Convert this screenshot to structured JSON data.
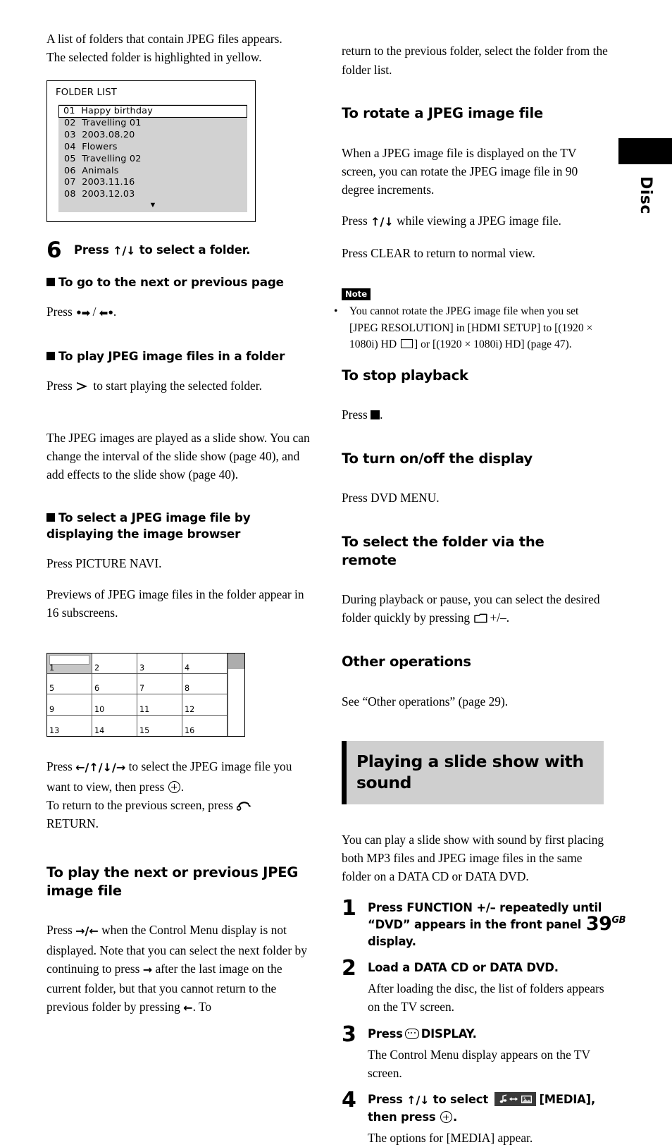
{
  "page": {
    "number": "39",
    "number_suffix": "GB",
    "side_tab_label": "Disc"
  },
  "left_column": {
    "intro": [
      "A list of folders that contain JPEG files appears.",
      "The selected folder is highlighted in yellow."
    ],
    "folder_list": {
      "title": "FOLDER LIST",
      "rows": [
        {
          "num": "01",
          "name": "Happy birthday",
          "selected": true
        },
        {
          "num": "02",
          "name": "Travelling 01",
          "selected": false
        },
        {
          "num": "03",
          "name": "2003.08.20",
          "selected": false
        },
        {
          "num": "04",
          "name": "Flowers",
          "selected": false
        },
        {
          "num": "05",
          "name": "Travelling 02",
          "selected": false
        },
        {
          "num": "06",
          "name": "Animals",
          "selected": false
        },
        {
          "num": "07",
          "name": "2003.11.16",
          "selected": false
        },
        {
          "num": "08",
          "name": "2003.12.03",
          "selected": false
        }
      ],
      "more_indicator": "▼"
    },
    "step6": {
      "number": "6",
      "lead_before": "Press ",
      "lead_arrows": "↑/↓",
      "lead_after": " to select a folder."
    },
    "sub_next_prev_page": {
      "heading": "To go to the next or previous page",
      "press_label": "Press",
      "trailing": "."
    },
    "sub_play_jpeg": {
      "heading": "To play JPEG image files in a folder",
      "press_label": "Press",
      "after_icon": " to start playing the selected folder.",
      "paragraph": "The JPEG images are played as a slide show. You can change the interval of the slide show (page 40), and add effects to the slide show (page 40)."
    },
    "sub_image_browser": {
      "heading_line1": "To select a JPEG image file by",
      "heading_line2": "displaying the image browser",
      "line1": "Press PICTURE NAVI.",
      "line2": "Previews of JPEG image files in the folder appear in 16 subscreens."
    },
    "subscreen_grid": {
      "cells": [
        "1",
        "2",
        "3",
        "4",
        "5",
        "6",
        "7",
        "8",
        "9",
        "10",
        "11",
        "12",
        "13",
        "14",
        "15",
        "16"
      ],
      "selected_cell": "1"
    },
    "grid_caption": {
      "press_label": "Press ",
      "arrows": "←/↑/↓/→",
      "mid": " to select the JPEG image file you want to view, then press",
      "after_enter": ".",
      "return_before": "To return to the previous screen, press",
      "return_label": "RETURN."
    },
    "sub_next_prev_jpeg": {
      "heading_line1": "To play the next or previous JPEG",
      "heading_line2": "image file",
      "press_label": "Press ",
      "arrows": "→/←",
      "text_a": " when the Control Menu display is not displayed. Note that you can select the next folder by continuing to press ",
      "arrow_right": "→",
      "text_b": " after the last image on the current folder, but that you cannot return to the previous folder by pressing ",
      "arrow_left": "←",
      "text_c": ". To"
    }
  },
  "right_column": {
    "continuation": "return to the previous folder, select the folder from the folder list.",
    "sub_rotate": {
      "heading": "To rotate a JPEG image file",
      "para1": "When a JPEG image file is displayed on the TV screen, you can rotate the JPEG image file in 90 degree increments.",
      "para2_before": "Press ",
      "para2_arrows": "↑/↓",
      "para2_after": " while viewing a JPEG image file.",
      "para3": "Press CLEAR to return to normal view."
    },
    "note": {
      "tag": "Note",
      "text_a": "You cannot rotate the JPEG image file when you set [JPEG RESOLUTION] in [HDMI SETUP] to [(1920 × 1080i) HD",
      "text_b": "] or [(1920 × 1080i) HD] (page 47)."
    },
    "sub_stop": {
      "heading": "To stop playback",
      "press_label": "Press",
      "trailing": "."
    },
    "sub_display": {
      "heading": "To turn on/off the display",
      "text": "Press DVD MENU."
    },
    "sub_select_folder": {
      "heading_line1": "To select the folder via the",
      "heading_line2": "remote",
      "text_before": "During playback or pause, you can select the desired folder quickly by pressing",
      "text_after": "+/–."
    },
    "sub_other": {
      "heading": "Other operations",
      "text": "See “Other operations” (page 29)."
    },
    "banner": {
      "line1": "Playing a slide show with",
      "line2": "sound"
    },
    "banner_intro": "You can play a slide show with sound by first placing both MP3 files and JPEG image files in the same folder on a DATA CD or DATA DVD.",
    "steps": [
      {
        "number": "1",
        "lead": "Press FUNCTION +/– repeatedly until “DVD” appears in the front panel display.",
        "desc": ""
      },
      {
        "number": "2",
        "lead": "Load a DATA CD or DATA DVD.",
        "desc": "After loading the disc, the list of folders appears on the TV screen."
      },
      {
        "number": "3",
        "lead_before": "Press",
        "lead_after": "DISPLAY.",
        "desc": "The Control Menu display appears on the TV screen."
      },
      {
        "number": "4",
        "lead_before": "Press ",
        "lead_arrows": "↑/↓",
        "lead_mid": " to select",
        "lead_after": "[MEDIA], then press",
        "lead_end": ".",
        "desc": "The options for [MEDIA] appear."
      }
    ]
  },
  "colors": {
    "banner_bg": "#cfcfcf",
    "folder_list_bg": "#d2d2d2",
    "grid_selected": "#c6c6c6",
    "text": "#000000"
  }
}
